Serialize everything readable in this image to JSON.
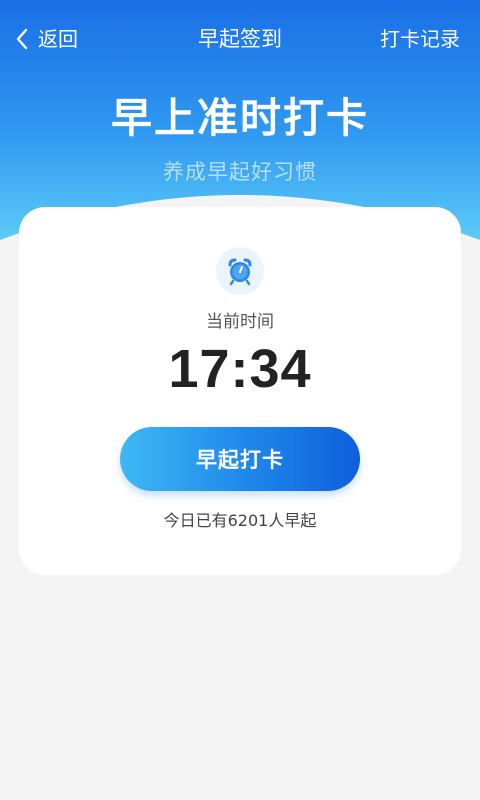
{
  "nav": {
    "back_label": "返回",
    "title": "早起签到",
    "records_label": "打卡记录"
  },
  "hero": {
    "title": "早上准时打卡",
    "subtitle": "养成早起好习惯"
  },
  "card": {
    "time_label": "当前时间",
    "time_value": "17:34",
    "button_label": "早起打卡",
    "count_text": "今日已有6201人早起"
  },
  "colors": {
    "header_gradient_top": "#1a73e8",
    "header_gradient_bottom": "#55c8f8",
    "button_gradient_start": "#3fb8f5",
    "button_gradient_end": "#0e5fdb",
    "page_background": "#f4f4f4"
  },
  "icons": {
    "back": "chevron-left-icon",
    "clock": "alarm-clock-icon"
  }
}
